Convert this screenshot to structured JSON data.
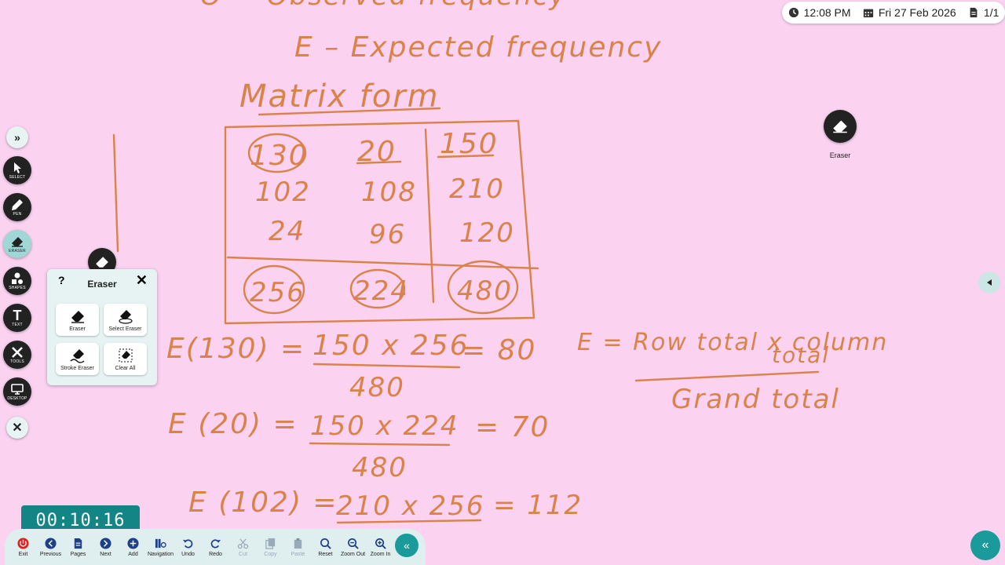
{
  "status": {
    "time": "12:08 PM",
    "date": "Fri 27 Feb 2026",
    "pages": "1/1"
  },
  "board": {
    "line_observed": "O = Observed frequency",
    "line_expected": "E – Expected frequency",
    "heading": "Matrix form",
    "matrix": {
      "rows": [
        [
          "130",
          "20",
          "150"
        ],
        [
          "102",
          "108",
          "210"
        ],
        [
          "24",
          "96",
          "120"
        ]
      ],
      "totals": [
        "256",
        "224",
        "480"
      ]
    },
    "formula_numerator": "E = Row total x column",
    "formula_numerator_2": "total",
    "formula_denominator": "Grand total",
    "calc1_left": "E(130) =",
    "calc1_num": "150 x 256",
    "calc1_den": "480",
    "calc1_res": "= 80",
    "calc2_left": "E (20) =",
    "calc2_num": "150 x 224",
    "calc2_den": "480",
    "calc2_res": "= 70",
    "calc3_left": "E (102) =",
    "calc3_num": "210 x 256",
    "calc3_res": "= 112"
  },
  "left_toolbar": {
    "select": "SELECT",
    "pen": "PEN",
    "eraser": "ERASER",
    "shapes": "SHAPES",
    "text": "TEXT",
    "tools": "TOOLS",
    "desktop": "DESKTOP"
  },
  "eraser_panel": {
    "title": "Eraser",
    "help": "?",
    "options": [
      "Eraser",
      "Select Eraser",
      "Stroke Eraser",
      "Clear All"
    ]
  },
  "eraser_float_label": "Eraser",
  "timer": "00:10:16",
  "bottom_bar": {
    "items": [
      "Exit",
      "Previous",
      "Pages",
      "Next",
      "Add",
      "Navigation",
      "Undo",
      "Redo",
      "Cut",
      "Copy",
      "Paste",
      "Reset",
      "Zoom Out",
      "Zoom In"
    ]
  },
  "colors": {
    "background": "#fbd3f1",
    "ink": "#d9834a",
    "accent": "#1a9a9a",
    "toolbar_dark": "#222222"
  }
}
